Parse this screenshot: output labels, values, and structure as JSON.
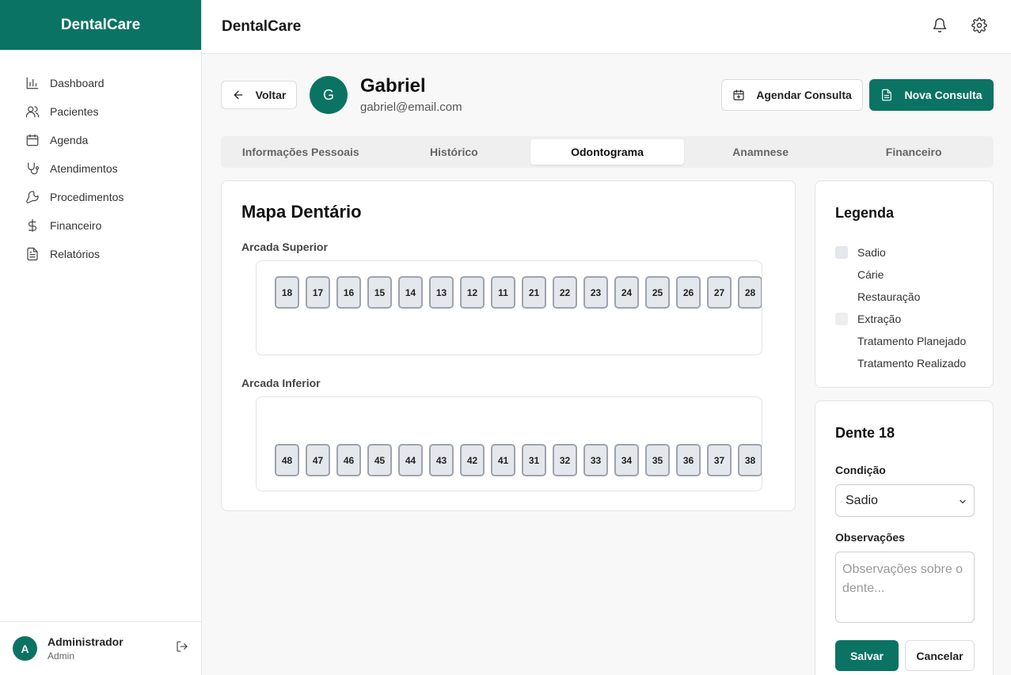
{
  "app": {
    "brand": "DentalCare",
    "header_title": "DentalCare"
  },
  "sidebar": {
    "items": [
      {
        "label": "Dashboard",
        "icon": "bar-chart-icon"
      },
      {
        "label": "Pacientes",
        "icon": "users-icon"
      },
      {
        "label": "Agenda",
        "icon": "calendar-icon"
      },
      {
        "label": "Atendimentos",
        "icon": "stethoscope-icon"
      },
      {
        "label": "Procedimentos",
        "icon": "wrench-icon"
      },
      {
        "label": "Financeiro",
        "icon": "dollar-icon"
      },
      {
        "label": "Relatórios",
        "icon": "file-text-icon"
      }
    ],
    "user": {
      "initial": "A",
      "name": "Administrador",
      "role": "Admin"
    }
  },
  "patient": {
    "back_label": "Voltar",
    "initial": "G",
    "name": "Gabriel",
    "email": "gabriel@email.com",
    "schedule_label": "Agendar Consulta",
    "new_consult_label": "Nova Consulta"
  },
  "tabs": [
    {
      "label": "Informações Pessoais",
      "active": false
    },
    {
      "label": "Histórico",
      "active": false
    },
    {
      "label": "Odontograma",
      "active": true
    },
    {
      "label": "Anamnese",
      "active": false
    },
    {
      "label": "Financeiro",
      "active": false
    }
  ],
  "odontogram": {
    "title": "Mapa Dentário",
    "upper_label": "Arcada Superior",
    "lower_label": "Arcada Inferior",
    "upper_teeth": [
      "18",
      "17",
      "16",
      "15",
      "14",
      "13",
      "12",
      "11",
      "21",
      "22",
      "23",
      "24",
      "25",
      "26",
      "27",
      "28"
    ],
    "lower_teeth": [
      "48",
      "47",
      "46",
      "45",
      "44",
      "43",
      "42",
      "41",
      "31",
      "32",
      "33",
      "34",
      "35",
      "36",
      "37",
      "38"
    ]
  },
  "legend": {
    "title": "Legenda",
    "items": [
      {
        "label": "Sadio",
        "color": "#e4e7ec"
      },
      {
        "label": "Cárie",
        "color": "#ffffff"
      },
      {
        "label": "Restauração",
        "color": "#ffffff"
      },
      {
        "label": "Extração",
        "color": "#eeeeee"
      },
      {
        "label": "Tratamento Planejado",
        "color": "#ffffff"
      },
      {
        "label": "Tratamento Realizado",
        "color": "#ffffff"
      }
    ]
  },
  "tooth_detail": {
    "title": "Dente 18",
    "condition_label": "Condição",
    "condition_value": "Sadio",
    "notes_label": "Observações",
    "notes_placeholder": "Observações sobre o dente...",
    "save_label": "Salvar",
    "cancel_label": "Cancelar"
  },
  "colors": {
    "brand": "#0b7363",
    "tooth_fill": "#e4e7ec",
    "tooth_border": "#9ea3ad"
  }
}
